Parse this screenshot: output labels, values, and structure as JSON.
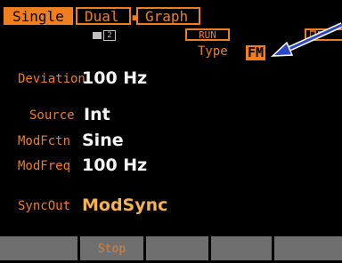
{
  "tabs": [
    {
      "label": "Single",
      "active": true
    },
    {
      "label": "Dual",
      "active": false
    },
    {
      "label": "Graph",
      "active": false
    }
  ],
  "channel_indicator": "2",
  "run_indicator": "RUN",
  "type": {
    "label": "Type",
    "value": "FM"
  },
  "params": {
    "deviation": {
      "label": "Deviation",
      "value": "100 Hz"
    },
    "source": {
      "label": "Source",
      "value": "Int"
    },
    "modfctn": {
      "label": "ModFctn",
      "value": "Sine"
    },
    "modfreq": {
      "label": "ModFreq",
      "value": "100 Hz"
    },
    "syncout": {
      "label": "SyncOut",
      "value": "ModSync"
    }
  },
  "softkeys": [
    "",
    "Stop",
    "",
    "",
    ""
  ],
  "colors": {
    "accent": "#f07e1e",
    "value_text": "#f5f5f5",
    "highlight_value": "#f6b24e",
    "softkey_bg": "#6f6f6f",
    "arrow": "#2d47c8"
  },
  "icons": {
    "annotation_arrow": "arrow-pointing-left-icon"
  }
}
